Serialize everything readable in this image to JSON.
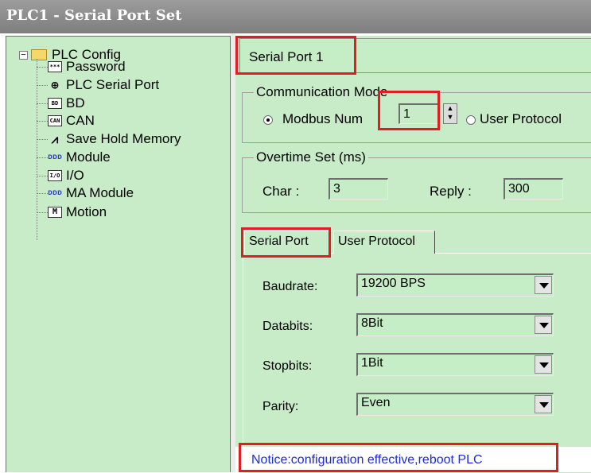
{
  "window": {
    "title": "PLC1 - Serial Port  Set"
  },
  "tree": {
    "root": "PLC Config",
    "items": [
      {
        "label": "Password",
        "icon": "password-icon",
        "glyph": "***"
      },
      {
        "label": "PLC Serial Port",
        "icon": "serial-port-icon",
        "glyph": "⊕"
      },
      {
        "label": "BD",
        "icon": "bd-icon",
        "glyph": "BD"
      },
      {
        "label": "CAN",
        "icon": "can-icon",
        "glyph": "CAN"
      },
      {
        "label": "Save Hold Memory",
        "icon": "memory-icon",
        "glyph": "⩘"
      },
      {
        "label": "Module",
        "icon": "module-icon",
        "glyph": "ᴅᴅᴅ"
      },
      {
        "label": "I/O",
        "icon": "io-icon",
        "glyph": "I/O"
      },
      {
        "label": "MA Module",
        "icon": "ma-module-icon",
        "glyph": "ᴅᴅᴅ"
      },
      {
        "label": "Motion",
        "icon": "motion-icon",
        "glyph": "M"
      }
    ]
  },
  "port": {
    "selected": "Serial Port 1"
  },
  "comm_mode": {
    "legend": "Communication Mode",
    "modbus_label": "Modbus Num",
    "modbus_value": "1",
    "user_protocol_label": "User Protocol",
    "selected": "modbus"
  },
  "overtime": {
    "legend": "Overtime Set (ms)",
    "char_label": "Char :",
    "char_value": "3",
    "reply_label": "Reply :",
    "reply_value": "300"
  },
  "tabs": [
    {
      "label": "Serial Port",
      "active": true
    },
    {
      "label": "User Protocol",
      "active": false
    }
  ],
  "serial": {
    "fields": [
      {
        "label": "Baudrate:",
        "value": "19200 BPS"
      },
      {
        "label": "Databits:",
        "value": "8Bit"
      },
      {
        "label": "Stopbits:",
        "value": "1Bit"
      },
      {
        "label": "Parity:",
        "value": "Even"
      }
    ]
  },
  "notice": "Notice:configuration effective,reboot PLC",
  "colors": {
    "panel": "#c8ecc8",
    "highlight": "#e11d24",
    "notice": "#1a2be0"
  }
}
